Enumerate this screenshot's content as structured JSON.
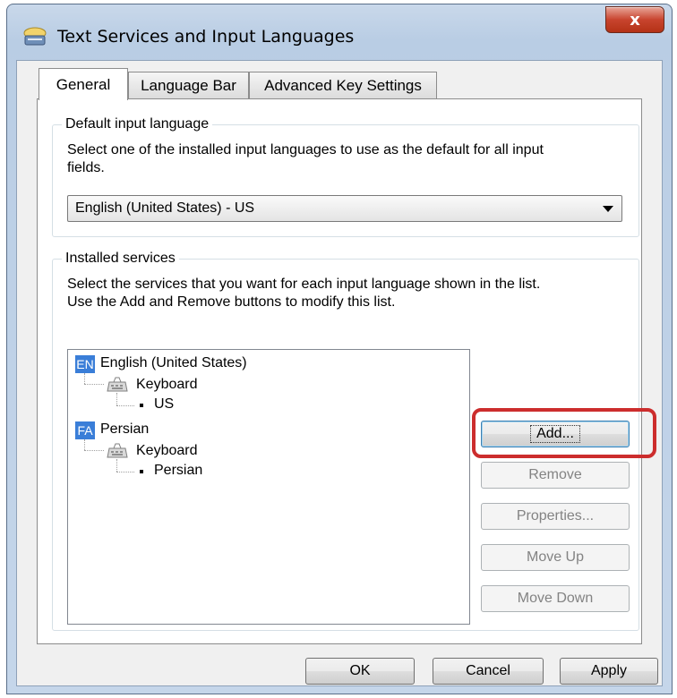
{
  "window": {
    "title": "Text Services and Input Languages",
    "close_glyph": "x"
  },
  "tabs": [
    {
      "label": "General",
      "active": true
    },
    {
      "label": "Language Bar",
      "active": false
    },
    {
      "label": "Advanced Key Settings",
      "active": false
    }
  ],
  "default_input": {
    "label": "Default input language",
    "description_line1": "Select one of the installed input languages to use as the default for all input",
    "description_line2": "fields.",
    "selected": "English (United States) - US"
  },
  "installed_services": {
    "label": "Installed services",
    "description_line1": "Select the services that you want for each input language shown in the list.",
    "description_line2": "Use the Add and Remove buttons to modify this list.",
    "languages": [
      {
        "badge": "EN",
        "name": "English (United States)",
        "category": "Keyboard",
        "layout": "US"
      },
      {
        "badge": "FA",
        "name": "Persian",
        "category": "Keyboard",
        "layout": "Persian"
      }
    ],
    "buttons": {
      "add": "Add...",
      "remove": "Remove",
      "properties": "Properties...",
      "move_up": "Move Up",
      "move_down": "Move Down"
    }
  },
  "footer": {
    "ok": "OK",
    "cancel": "Cancel",
    "apply": "Apply"
  },
  "colors": {
    "highlight": "#cc2d2d",
    "lang_badge": "#3a7ed8",
    "close_button": "#c8442e"
  }
}
